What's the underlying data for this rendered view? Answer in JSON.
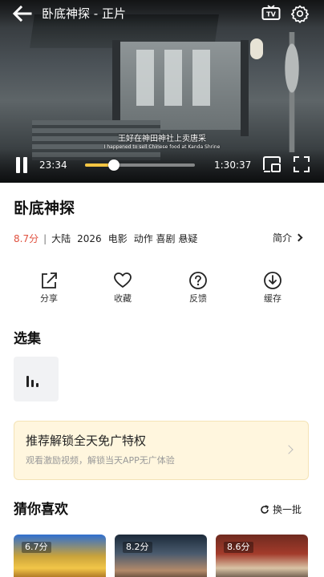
{
  "player": {
    "title": "卧底神探 - 正片",
    "subtitle_cn": "王好在神田神社上卖唐采",
    "subtitle_en": "I happened to sell Chinese food at Kanda Shrine",
    "time_current": "23:34",
    "time_total": "1:30:37",
    "progress": 0.26
  },
  "movie": {
    "title": "卧底神探",
    "rating": "8.7分",
    "separator": "|",
    "region": "大陆",
    "year": "2026",
    "type": "电影",
    "genres": "动作 喜剧 悬疑",
    "intro_label": "简介"
  },
  "actions": [
    {
      "label": "分享",
      "icon": "share-icon"
    },
    {
      "label": "收藏",
      "icon": "heart-icon"
    },
    {
      "label": "反馈",
      "icon": "question-icon"
    },
    {
      "label": "缓存",
      "icon": "download-icon"
    }
  ],
  "episodes": {
    "title": "选集"
  },
  "promo": {
    "title": "推荐解锁全天免广特权",
    "subtitle": "观看激励视频，解锁当天APP无广体验"
  },
  "recommend": {
    "title": "猜你喜欢",
    "refresh_label": "换一批",
    "items": [
      {
        "rating": "6.7分"
      },
      {
        "rating": "8.2分"
      },
      {
        "rating": "8.6分"
      }
    ]
  },
  "colors": {
    "rating": "#e0513f",
    "progress": "#f4c542",
    "promo_bg": "#fff6de"
  }
}
